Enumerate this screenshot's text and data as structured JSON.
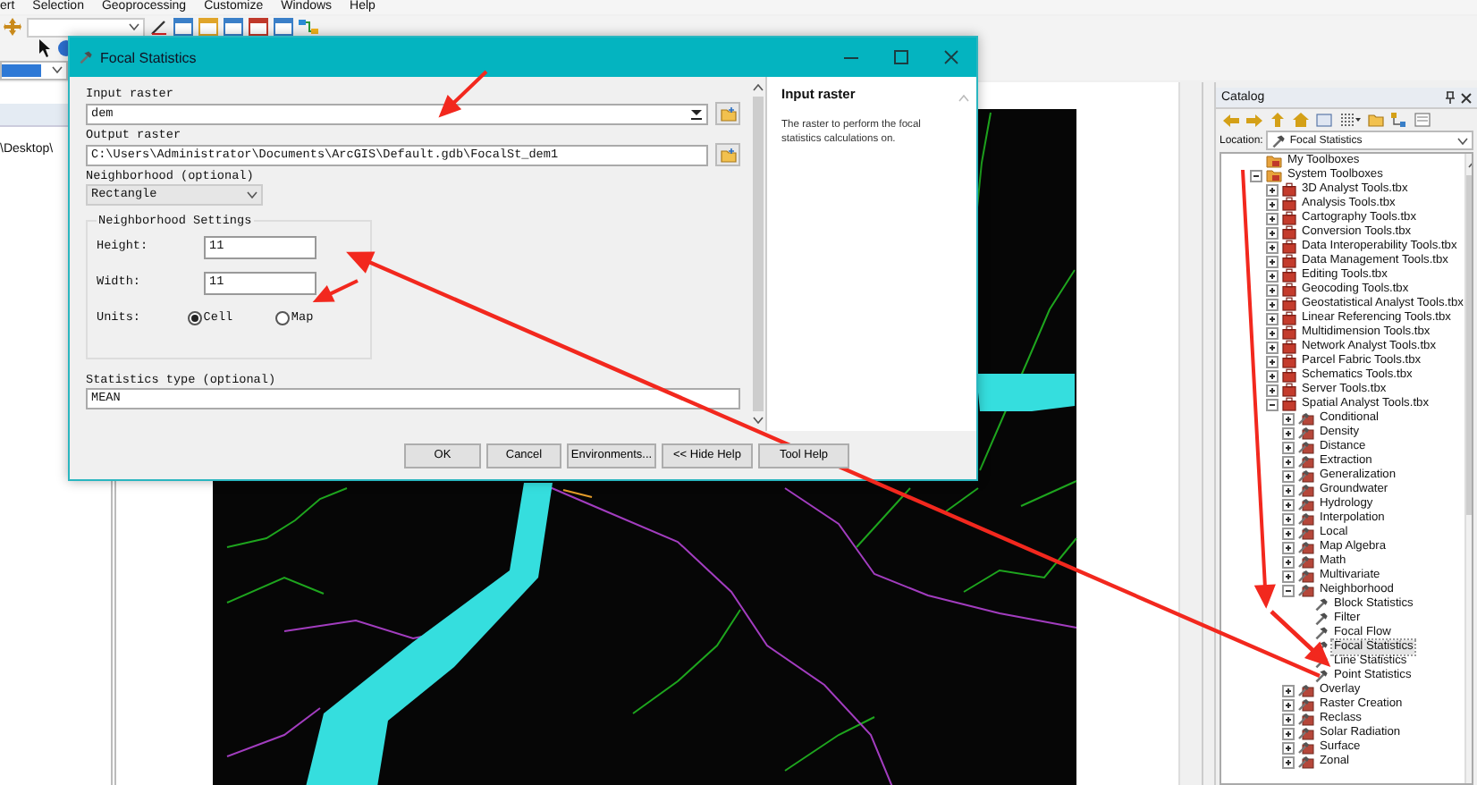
{
  "menubar": [
    "ert",
    "Selection",
    "Geoprocessing",
    "Customize",
    "Windows",
    "Help"
  ],
  "toc": {
    "path": "\\Desktop\\"
  },
  "dialog": {
    "title": "Focal Statistics",
    "input_raster": {
      "label": "Input raster",
      "value": "dem"
    },
    "output_raster": {
      "label": "Output raster",
      "value": "C:\\Users\\Administrator\\Documents\\ArcGIS\\Default.gdb\\FocalSt_dem1"
    },
    "neighborhood": {
      "label": "Neighborhood (optional)",
      "value": "Rectangle"
    },
    "settings": {
      "title": "Neighborhood Settings",
      "height": {
        "label": "Height:",
        "value": "11"
      },
      "width": {
        "label": "Width:",
        "value": "11"
      },
      "units": {
        "label": "Units:",
        "options": [
          {
            "label": "Cell",
            "selected": true
          },
          {
            "label": "Map",
            "selected": false
          }
        ]
      }
    },
    "statistics_type": {
      "label": "Statistics type (optional)",
      "value": "MEAN"
    },
    "buttons": [
      "OK",
      "Cancel",
      "Environments...",
      "<< Hide Help",
      "Tool Help"
    ],
    "help": {
      "title": "Input raster",
      "text": "The raster to perform the focal statistics calculations on."
    }
  },
  "catalog": {
    "title": "Catalog",
    "location_label": "Location:",
    "location": "Focal Statistics",
    "tree": [
      {
        "label": "My Toolboxes",
        "kind": "folder",
        "selected": false
      },
      {
        "label": "System Toolboxes",
        "kind": "folder",
        "selected": false,
        "expanded": true,
        "children": [
          {
            "label": "3D Analyst Tools.tbx",
            "kind": "toolbox",
            "selected": false,
            "expanded": false
          },
          {
            "label": "Analysis Tools.tbx",
            "kind": "toolbox",
            "selected": false,
            "expanded": false
          },
          {
            "label": "Cartography Tools.tbx",
            "kind": "toolbox",
            "selected": false,
            "expanded": false
          },
          {
            "label": "Conversion Tools.tbx",
            "kind": "toolbox",
            "selected": false,
            "expanded": false
          },
          {
            "label": "Data Interoperability Tools.tbx",
            "kind": "toolbox",
            "selected": false,
            "expanded": false
          },
          {
            "label": "Data Management Tools.tbx",
            "kind": "toolbox",
            "selected": false,
            "expanded": false
          },
          {
            "label": "Editing Tools.tbx",
            "kind": "toolbox",
            "selected": false,
            "expanded": false
          },
          {
            "label": "Geocoding Tools.tbx",
            "kind": "toolbox",
            "selected": false,
            "expanded": false
          },
          {
            "label": "Geostatistical Analyst Tools.tbx",
            "kind": "toolbox",
            "selected": false,
            "expanded": false
          },
          {
            "label": "Linear Referencing Tools.tbx",
            "kind": "toolbox",
            "selected": false,
            "expanded": false
          },
          {
            "label": "Multidimension Tools.tbx",
            "kind": "toolbox",
            "selected": false,
            "expanded": false
          },
          {
            "label": "Network Analyst Tools.tbx",
            "kind": "toolbox",
            "selected": false,
            "expanded": false
          },
          {
            "label": "Parcel Fabric Tools.tbx",
            "kind": "toolbox",
            "selected": false,
            "expanded": false
          },
          {
            "label": "Schematics Tools.tbx",
            "kind": "toolbox",
            "selected": false,
            "expanded": false
          },
          {
            "label": "Server Tools.tbx",
            "kind": "toolbox",
            "selected": false,
            "expanded": false
          },
          {
            "label": "Spatial Analyst Tools.tbx",
            "kind": "toolbox",
            "selected": false,
            "expanded": true,
            "children": [
              {
                "label": "Conditional",
                "kind": "toolset",
                "selected": false,
                "expanded": false
              },
              {
                "label": "Density",
                "kind": "toolset",
                "selected": false,
                "expanded": false
              },
              {
                "label": "Distance",
                "kind": "toolset",
                "selected": false,
                "expanded": false
              },
              {
                "label": "Extraction",
                "kind": "toolset",
                "selected": false,
                "expanded": false
              },
              {
                "label": "Generalization",
                "kind": "toolset",
                "selected": false,
                "expanded": false
              },
              {
                "label": "Groundwater",
                "kind": "toolset",
                "selected": false,
                "expanded": false
              },
              {
                "label": "Hydrology",
                "kind": "toolset",
                "selected": false,
                "expanded": false
              },
              {
                "label": "Interpolation",
                "kind": "toolset",
                "selected": false,
                "expanded": false
              },
              {
                "label": "Local",
                "kind": "toolset",
                "selected": false,
                "expanded": false
              },
              {
                "label": "Map Algebra",
                "kind": "toolset",
                "selected": false,
                "expanded": false
              },
              {
                "label": "Math",
                "kind": "toolset",
                "selected": false,
                "expanded": false
              },
              {
                "label": "Multivariate",
                "kind": "toolset",
                "selected": false,
                "expanded": false
              },
              {
                "label": "Neighborhood",
                "kind": "toolset",
                "selected": false,
                "expanded": true,
                "children": [
                  {
                    "label": "Block Statistics",
                    "kind": "tool",
                    "selected": false
                  },
                  {
                    "label": "Filter",
                    "kind": "tool",
                    "selected": false
                  },
                  {
                    "label": "Focal Flow",
                    "kind": "tool",
                    "selected": false
                  },
                  {
                    "label": "Focal Statistics",
                    "kind": "tool",
                    "selected": true
                  },
                  {
                    "label": "Line Statistics",
                    "kind": "tool",
                    "selected": false
                  },
                  {
                    "label": "Point Statistics",
                    "kind": "tool",
                    "selected": false
                  }
                ]
              },
              {
                "label": "Overlay",
                "kind": "toolset",
                "selected": false,
                "expanded": false
              },
              {
                "label": "Raster Creation",
                "kind": "toolset",
                "selected": false,
                "expanded": false
              },
              {
                "label": "Reclass",
                "kind": "toolset",
                "selected": false,
                "expanded": false
              },
              {
                "label": "Solar Radiation",
                "kind": "toolset",
                "selected": false,
                "expanded": false
              },
              {
                "label": "Surface",
                "kind": "toolset",
                "selected": false,
                "expanded": false
              },
              {
                "label": "Zonal",
                "kind": "toolset",
                "selected": false,
                "expanded": false
              }
            ]
          }
        ]
      }
    ]
  }
}
